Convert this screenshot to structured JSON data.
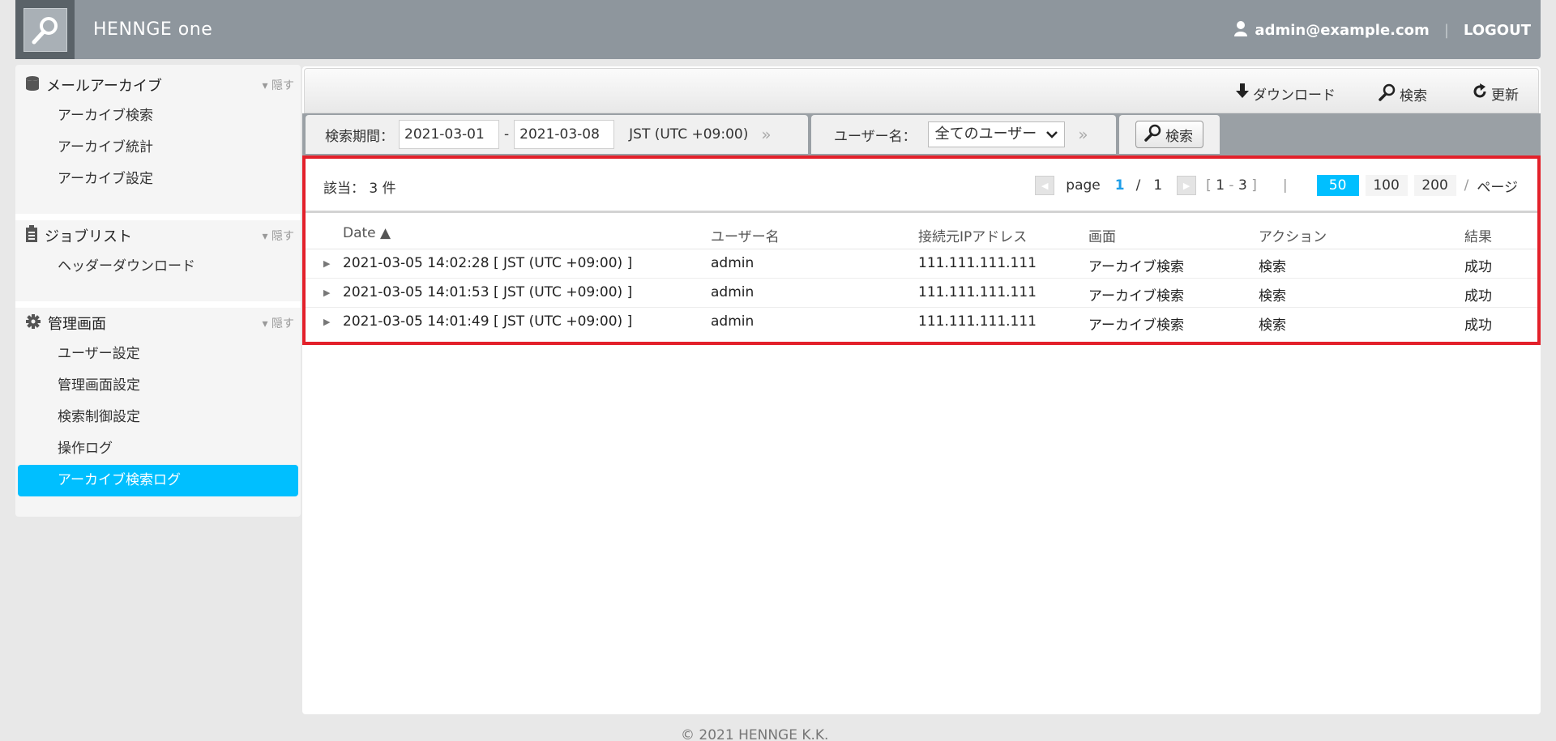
{
  "header": {
    "brand": "HENNGE one",
    "user_email": "admin@example.com",
    "logout_label": "LOGOUT"
  },
  "sidebar": {
    "sections": [
      {
        "title": "メールアーカイブ",
        "hide": "隠す",
        "icon": "database-icon",
        "items": [
          "アーカイブ検索",
          "アーカイブ統計",
          "アーカイブ設定"
        ]
      },
      {
        "title": "ジョブリスト",
        "hide": "隠す",
        "icon": "clipboard-icon",
        "items": [
          "ヘッダーダウンロード"
        ]
      },
      {
        "title": "管理画面",
        "hide": "隠す",
        "icon": "gear-icon",
        "items": [
          "ユーザー設定",
          "管理画面設定",
          "検索制御設定",
          "操作ログ",
          "アーカイブ検索ログ"
        ]
      }
    ],
    "active_item": "アーカイブ検索ログ"
  },
  "toolbar": {
    "download_label": "ダウンロード",
    "search_label": "検索",
    "refresh_label": "更新"
  },
  "filter": {
    "period_label": "検索期間：",
    "date_from": "2021-03-01",
    "dash": "-",
    "date_to": "2021-03-08",
    "timezone": "JST (UTC +09:00)",
    "user_label": "ユーザー名：",
    "user_value": "全てのユーザー",
    "search_button": "検索"
  },
  "results": {
    "count_text": "該当： 3 件",
    "pager": {
      "page_word": "page",
      "current": "1",
      "slash": "/",
      "total": "1",
      "range_start": "1",
      "range_end": "3",
      "per_page_options": [
        "50",
        "100",
        "200"
      ],
      "per_page_selected": "50",
      "page_suffix": "ページ"
    },
    "columns": [
      "Date",
      "ユーザー名",
      "接続元IPアドレス",
      "画面",
      "アクション",
      "結果"
    ],
    "rows": [
      {
        "date": "2021-03-05 14:02:28 [ JST (UTC +09:00) ]",
        "user": "admin",
        "ip": "111.111.111.111",
        "screen": "アーカイブ検索",
        "action": "検索",
        "result": "成功"
      },
      {
        "date": "2021-03-05 14:01:53 [ JST (UTC +09:00) ]",
        "user": "admin",
        "ip": "111.111.111.111",
        "screen": "アーカイブ検索",
        "action": "検索",
        "result": "成功"
      },
      {
        "date": "2021-03-05 14:01:49 [ JST (UTC +09:00) ]",
        "user": "admin",
        "ip": "111.111.111.111",
        "screen": "アーカイブ検索",
        "action": "検索",
        "result": "成功"
      }
    ]
  },
  "footer": {
    "copyright": "© 2021 HENNGE K.K."
  }
}
